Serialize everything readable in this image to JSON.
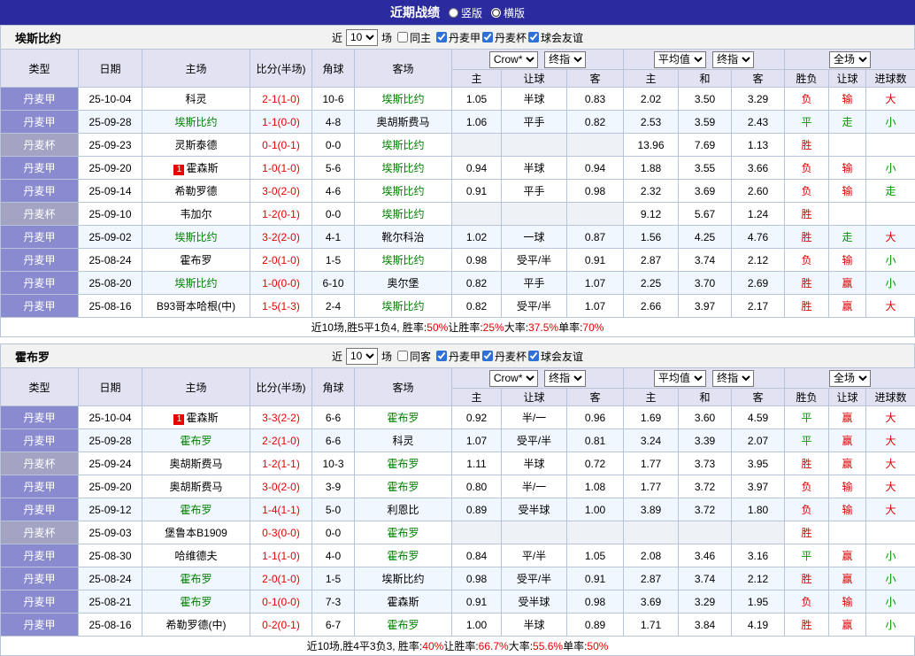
{
  "topbar": {
    "title": "近期战绩",
    "options": [
      {
        "label": "竖版",
        "selected": false
      },
      {
        "label": "横版",
        "selected": true
      }
    ]
  },
  "ui": {
    "near": "近",
    "games": "场"
  },
  "colors": {
    "topbar_bg": "#2b2b9f",
    "header_bg": "#e2e2f2",
    "score_red": "#e60000",
    "team_green": "#008000",
    "home_row_bg": "#f1f7fe",
    "league_map": {
      "丹麦甲": "#8a8ad0",
      "丹麦杯": "#a3a3c3"
    },
    "result_map": {
      "胜": "#dd0000",
      "负": "#dd0000",
      "平": "#009900",
      "赢": "#dd0000",
      "输": "#dd0000",
      "走": "#009900",
      "大": "#dd0000",
      "小": "#009900"
    }
  },
  "table_header": {
    "type": "类型",
    "date": "日期",
    "home": "主场",
    "score": "比分(半场)",
    "corner": "角球",
    "away": "客场",
    "bookmaker": "Crow*",
    "final1": "终指",
    "average": "平均值",
    "final2": "终指",
    "fulltime": "全场",
    "asian": [
      "主",
      "让球",
      "客"
    ],
    "euro": [
      "主",
      "和",
      "客"
    ],
    "result": [
      "胜负",
      "让球",
      "进球数"
    ]
  },
  "teams": [
    {
      "name": "埃斯比约",
      "filter": {
        "count": "10",
        "same_label": "同主",
        "same_checked": false,
        "leagues": [
          {
            "label": "丹麦甲",
            "checked": true
          },
          {
            "label": "丹麦杯",
            "checked": true
          },
          {
            "label": "球会友谊",
            "checked": true
          }
        ]
      },
      "rows": [
        {
          "league": "丹麦甲",
          "date": "25-10-04",
          "home": "科灵",
          "home_green": false,
          "home_badge": "",
          "score": "2-1(1-0)",
          "corner": "10-6",
          "away": "埃斯比约",
          "away_green": true,
          "away_badge": "",
          "odds": [
            "1.05",
            "半球",
            "0.83"
          ],
          "euro": [
            "2.02",
            "3.50",
            "3.29"
          ],
          "results": [
            "负",
            "输",
            "大"
          ]
        },
        {
          "league": "丹麦甲",
          "date": "25-09-28",
          "home": "埃斯比约",
          "home_green": true,
          "home_badge": "",
          "score": "1-1(0-0)",
          "corner": "4-8",
          "away": "奥胡斯费马",
          "away_green": false,
          "away_badge": "",
          "odds": [
            "1.06",
            "平手",
            "0.82"
          ],
          "euro": [
            "2.53",
            "3.59",
            "2.43"
          ],
          "results": [
            "平",
            "走",
            "小"
          ]
        },
        {
          "league": "丹麦杯",
          "date": "25-09-23",
          "home": "灵斯泰德",
          "home_green": false,
          "home_badge": "",
          "score": "0-1(0-1)",
          "corner": "0-0",
          "away": "埃斯比约",
          "away_green": true,
          "away_badge": "",
          "odds": [
            "",
            "",
            ""
          ],
          "euro": [
            "13.96",
            "7.69",
            "1.13"
          ],
          "results": [
            "胜",
            "",
            ""
          ]
        },
        {
          "league": "丹麦甲",
          "date": "25-09-20",
          "home": "霍森斯",
          "home_green": false,
          "home_badge": "1",
          "score": "1-0(1-0)",
          "corner": "5-6",
          "away": "埃斯比约",
          "away_green": true,
          "away_badge": "",
          "odds": [
            "0.94",
            "半球",
            "0.94"
          ],
          "euro": [
            "1.88",
            "3.55",
            "3.66"
          ],
          "results": [
            "负",
            "输",
            "小"
          ]
        },
        {
          "league": "丹麦甲",
          "date": "25-09-14",
          "home": "希勒罗德",
          "home_green": false,
          "home_badge": "",
          "score": "3-0(2-0)",
          "corner": "4-6",
          "away": "埃斯比约",
          "away_green": true,
          "away_badge": "",
          "odds": [
            "0.91",
            "平手",
            "0.98"
          ],
          "euro": [
            "2.32",
            "3.69",
            "2.60"
          ],
          "results": [
            "负",
            "输",
            "走"
          ]
        },
        {
          "league": "丹麦杯",
          "date": "25-09-10",
          "home": "韦加尔",
          "home_green": false,
          "home_badge": "",
          "score": "1-2(0-1)",
          "corner": "0-0",
          "away": "埃斯比约",
          "away_green": true,
          "away_badge": "",
          "odds": [
            "",
            "",
            ""
          ],
          "euro": [
            "9.12",
            "5.67",
            "1.24"
          ],
          "results": [
            "胜",
            "",
            ""
          ]
        },
        {
          "league": "丹麦甲",
          "date": "25-09-02",
          "home": "埃斯比约",
          "home_green": true,
          "home_badge": "",
          "score": "3-2(2-0)",
          "corner": "4-1",
          "away": "靴尔科治",
          "away_green": false,
          "away_badge": "",
          "odds": [
            "1.02",
            "一球",
            "0.87"
          ],
          "euro": [
            "1.56",
            "4.25",
            "4.76"
          ],
          "results": [
            "胜",
            "走",
            "大"
          ]
        },
        {
          "league": "丹麦甲",
          "date": "25-08-24",
          "home": "霍布罗",
          "home_green": false,
          "home_badge": "",
          "score": "2-0(1-0)",
          "corner": "1-5",
          "away": "埃斯比约",
          "away_green": true,
          "away_badge": "",
          "odds": [
            "0.98",
            "受平/半",
            "0.91"
          ],
          "euro": [
            "2.87",
            "3.74",
            "2.12"
          ],
          "results": [
            "负",
            "输",
            "小"
          ]
        },
        {
          "league": "丹麦甲",
          "date": "25-08-20",
          "home": "埃斯比约",
          "home_green": true,
          "home_badge": "",
          "score": "1-0(0-0)",
          "corner": "6-10",
          "away": "奥尔堡",
          "away_green": false,
          "away_badge": "",
          "odds": [
            "0.82",
            "平手",
            "1.07"
          ],
          "euro": [
            "2.25",
            "3.70",
            "2.69"
          ],
          "results": [
            "胜",
            "赢",
            "小"
          ]
        },
        {
          "league": "丹麦甲",
          "date": "25-08-16",
          "home": "B93哥本哈根(中)",
          "home_green": false,
          "home_badge": "",
          "score": "1-5(1-3)",
          "corner": "2-4",
          "away": "埃斯比约",
          "away_green": true,
          "away_badge": "",
          "odds": [
            "0.82",
            "受平/半",
            "1.07"
          ],
          "euro": [
            "2.66",
            "3.97",
            "2.17"
          ],
          "results": [
            "胜",
            "赢",
            "大"
          ]
        }
      ],
      "summary": [
        {
          "text": "近10场,胜5平1负4, 胜率:",
          "red": false
        },
        {
          "text": "50%",
          "red": true
        },
        {
          "text": " 让胜率:",
          "red": false
        },
        {
          "text": "25%",
          "red": true
        },
        {
          "text": " 大率:",
          "red": false
        },
        {
          "text": "37.5%",
          "red": true
        },
        {
          "text": " 单率:",
          "red": false
        },
        {
          "text": "70%",
          "red": true
        }
      ]
    },
    {
      "name": "霍布罗",
      "filter": {
        "count": "10",
        "same_label": "同客",
        "same_checked": false,
        "leagues": [
          {
            "label": "丹麦甲",
            "checked": true
          },
          {
            "label": "丹麦杯",
            "checked": true
          },
          {
            "label": "球会友谊",
            "checked": true
          }
        ]
      },
      "rows": [
        {
          "league": "丹麦甲",
          "date": "25-10-04",
          "home": "霍森斯",
          "home_green": false,
          "home_badge": "1",
          "score": "3-3(2-2)",
          "corner": "6-6",
          "away": "霍布罗",
          "away_green": true,
          "away_badge": "",
          "odds": [
            "0.92",
            "半/一",
            "0.96"
          ],
          "euro": [
            "1.69",
            "3.60",
            "4.59"
          ],
          "results": [
            "平",
            "赢",
            "大"
          ]
        },
        {
          "league": "丹麦甲",
          "date": "25-09-28",
          "home": "霍布罗",
          "home_green": true,
          "home_badge": "",
          "score": "2-2(1-0)",
          "corner": "6-6",
          "away": "科灵",
          "away_green": false,
          "away_badge": "",
          "odds": [
            "1.07",
            "受平/半",
            "0.81"
          ],
          "euro": [
            "3.24",
            "3.39",
            "2.07"
          ],
          "results": [
            "平",
            "赢",
            "大"
          ]
        },
        {
          "league": "丹麦杯",
          "date": "25-09-24",
          "home": "奥胡斯费马",
          "home_green": false,
          "home_badge": "",
          "score": "1-2(1-1)",
          "corner": "10-3",
          "away": "霍布罗",
          "away_green": true,
          "away_badge": "",
          "odds": [
            "1.11",
            "半球",
            "0.72"
          ],
          "euro": [
            "1.77",
            "3.73",
            "3.95"
          ],
          "results": [
            "胜",
            "赢",
            "大"
          ]
        },
        {
          "league": "丹麦甲",
          "date": "25-09-20",
          "home": "奥胡斯费马",
          "home_green": false,
          "home_badge": "",
          "score": "3-0(2-0)",
          "corner": "3-9",
          "away": "霍布罗",
          "away_green": true,
          "away_badge": "",
          "odds": [
            "0.80",
            "半/一",
            "1.08"
          ],
          "euro": [
            "1.77",
            "3.72",
            "3.97"
          ],
          "results": [
            "负",
            "输",
            "大"
          ]
        },
        {
          "league": "丹麦甲",
          "date": "25-09-12",
          "home": "霍布罗",
          "home_green": true,
          "home_badge": "",
          "score": "1-4(1-1)",
          "corner": "5-0",
          "away": "利恩比",
          "away_green": false,
          "away_badge": "",
          "odds": [
            "0.89",
            "受半球",
            "1.00"
          ],
          "euro": [
            "3.89",
            "3.72",
            "1.80"
          ],
          "results": [
            "负",
            "输",
            "大"
          ]
        },
        {
          "league": "丹麦杯",
          "date": "25-09-03",
          "home": "堡鲁本B1909",
          "home_green": false,
          "home_badge": "",
          "score": "0-3(0-0)",
          "corner": "0-0",
          "away": "霍布罗",
          "away_green": true,
          "away_badge": "",
          "odds": [
            "",
            "",
            ""
          ],
          "euro": [
            "",
            "",
            ""
          ],
          "results": [
            "胜",
            "",
            ""
          ]
        },
        {
          "league": "丹麦甲",
          "date": "25-08-30",
          "home": "哈维德夫",
          "home_green": false,
          "home_badge": "",
          "score": "1-1(1-0)",
          "corner": "4-0",
          "away": "霍布罗",
          "away_green": true,
          "away_badge": "",
          "odds": [
            "0.84",
            "平/半",
            "1.05"
          ],
          "euro": [
            "2.08",
            "3.46",
            "3.16"
          ],
          "results": [
            "平",
            "赢",
            "小"
          ]
        },
        {
          "league": "丹麦甲",
          "date": "25-08-24",
          "home": "霍布罗",
          "home_green": true,
          "home_badge": "",
          "score": "2-0(1-0)",
          "corner": "1-5",
          "away": "埃斯比约",
          "away_green": false,
          "away_badge": "",
          "odds": [
            "0.98",
            "受平/半",
            "0.91"
          ],
          "euro": [
            "2.87",
            "3.74",
            "2.12"
          ],
          "results": [
            "胜",
            "赢",
            "小"
          ]
        },
        {
          "league": "丹麦甲",
          "date": "25-08-21",
          "home": "霍布罗",
          "home_green": true,
          "home_badge": "",
          "score": "0-1(0-0)",
          "corner": "7-3",
          "away": "霍森斯",
          "away_green": false,
          "away_badge": "",
          "odds": [
            "0.91",
            "受半球",
            "0.98"
          ],
          "euro": [
            "3.69",
            "3.29",
            "1.95"
          ],
          "results": [
            "负",
            "输",
            "小"
          ]
        },
        {
          "league": "丹麦甲",
          "date": "25-08-16",
          "home": "希勒罗德(中)",
          "home_green": false,
          "home_badge": "",
          "score": "0-2(0-1)",
          "corner": "6-7",
          "away": "霍布罗",
          "away_green": true,
          "away_badge": "",
          "odds": [
            "1.00",
            "半球",
            "0.89"
          ],
          "euro": [
            "1.71",
            "3.84",
            "4.19"
          ],
          "results": [
            "胜",
            "赢",
            "小"
          ]
        }
      ],
      "summary": [
        {
          "text": "近10场,胜4平3负3, 胜率:",
          "red": false
        },
        {
          "text": "40%",
          "red": true
        },
        {
          "text": " 让胜率:",
          "red": false
        },
        {
          "text": "66.7%",
          "red": true
        },
        {
          "text": " 大率:",
          "red": false
        },
        {
          "text": "55.6%",
          "red": true
        },
        {
          "text": " 单率:",
          "red": false
        },
        {
          "text": "50%",
          "red": true
        }
      ]
    }
  ]
}
